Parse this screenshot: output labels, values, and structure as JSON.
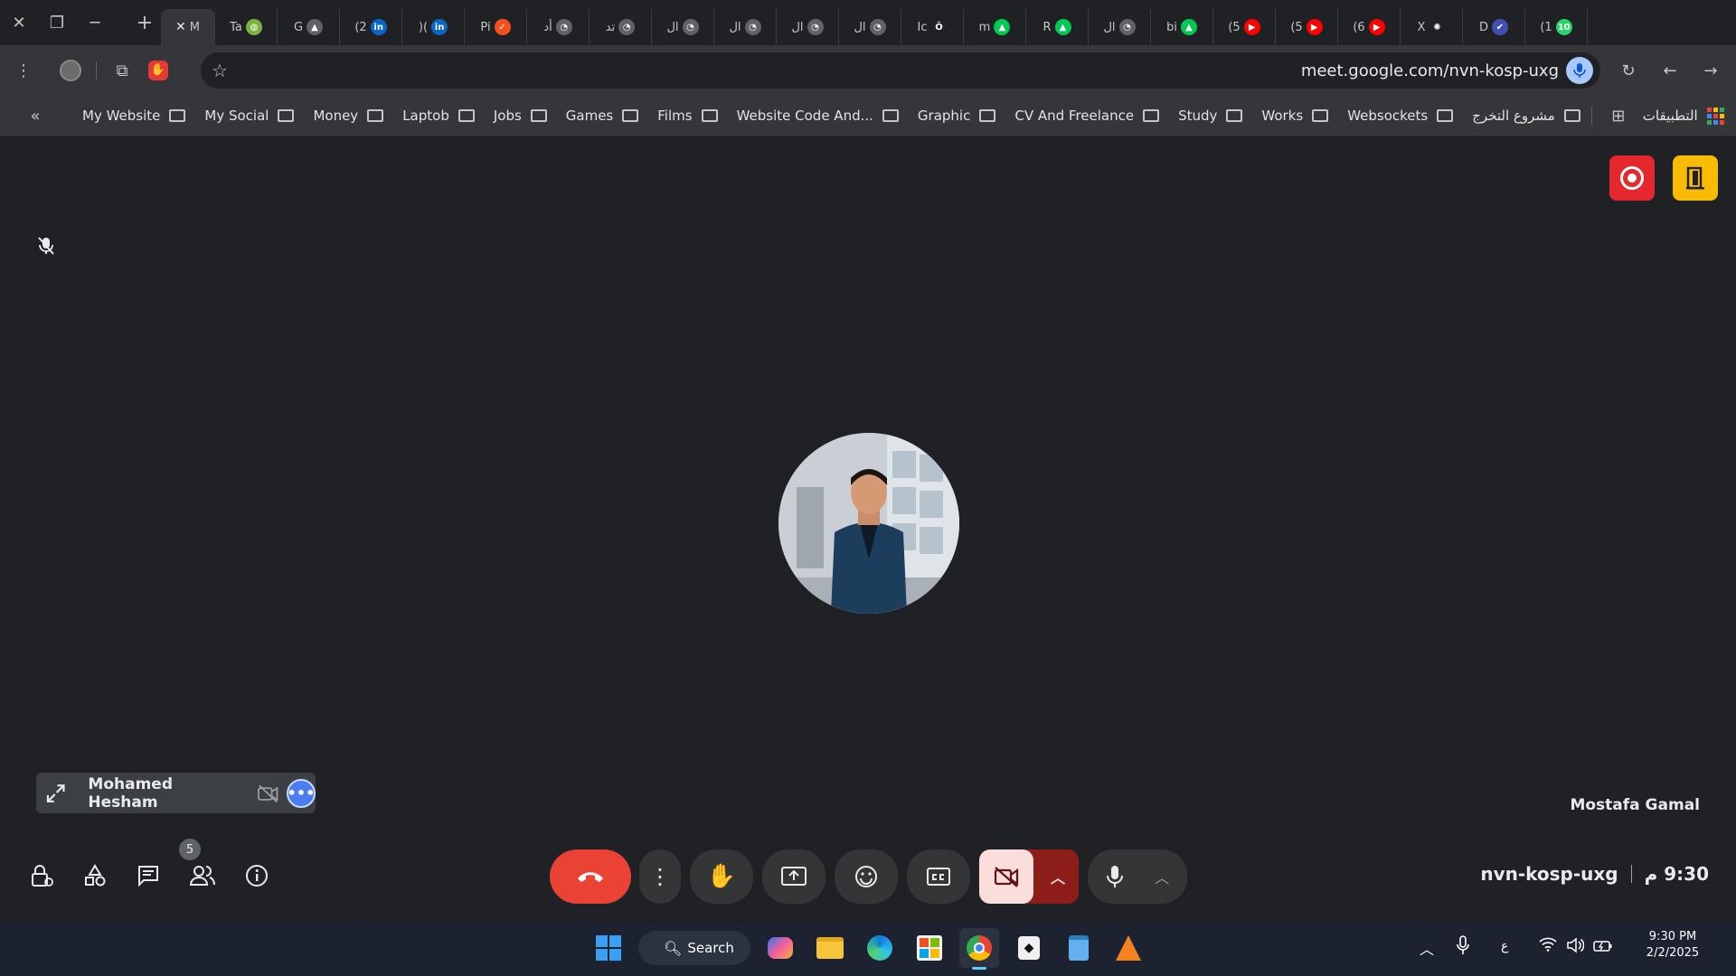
{
  "tabs": [
    {
      "label": "Ta",
      "fav_color": "#7cb342",
      "fav": "◍"
    },
    {
      "label": "G",
      "fav_color": "#5f6368",
      "fav": "▲"
    },
    {
      "label": "(2",
      "fav_color": "#0a66c2",
      "fav": "in"
    },
    {
      "label": ")(",
      "fav_color": "#0a66c2",
      "fav": "in"
    },
    {
      "label": "Pi",
      "fav_color": "#f4511e",
      "fav": "✓"
    },
    {
      "label": "أد",
      "fav_color": "#5f6368",
      "fav": "◔"
    },
    {
      "label": "تد",
      "fav_color": "#5f6368",
      "fav": "◔"
    },
    {
      "label": "ال",
      "fav_color": "#5f6368",
      "fav": "◔"
    },
    {
      "label": "ال",
      "fav_color": "#5f6368",
      "fav": "◔"
    },
    {
      "label": "ال",
      "fav_color": "#5f6368",
      "fav": "◔"
    },
    {
      "label": "ال",
      "fav_color": "#5f6368",
      "fav": "◔"
    },
    {
      "label": "Ic",
      "fav_color": "#202124",
      "fav": "Ô"
    },
    {
      "label": "m",
      "fav_color": "#00c853",
      "fav": "▲"
    },
    {
      "label": "R",
      "fav_color": "#00c853",
      "fav": "▲"
    },
    {
      "label": "ال",
      "fav_color": "#5f6368",
      "fav": "◔"
    },
    {
      "label": "bi",
      "fav_color": "#00c853",
      "fav": "▲"
    },
    {
      "label": "(5",
      "fav_color": "#ff0000",
      "fav": "▶"
    },
    {
      "label": "(5",
      "fav_color": "#ff0000",
      "fav": "▶"
    },
    {
      "label": "(6",
      "fav_color": "#ff0000",
      "fav": "▶"
    },
    {
      "label": "X",
      "fav_color": "#202124",
      "fav": "✺"
    },
    {
      "label": "D",
      "fav_color": "#3f51b5",
      "fav": "✔"
    },
    {
      "label": "(1",
      "fav_color": "#25d366",
      "fav": "10"
    }
  ],
  "active_tab": {
    "label": "M"
  },
  "url": "meet.google.com/nvn-kosp-uxg",
  "bookmarks": [
    "My Website",
    "My Social",
    "Money",
    "Laptob",
    "Jobs",
    "Games",
    "Films",
    "Website Code And...",
    "Graphic",
    "CV And Freelance",
    "Study",
    "Works",
    "Websockets",
    "مشروع التخرج"
  ],
  "apps_label": "التطبيقات",
  "meeting": {
    "self_name": "Mohamed Hesham",
    "remote_name": "Mostafa Gamal",
    "meeting_code": "nvn-kosp-uxg",
    "time": "9:30 م",
    "people_count": "5"
  },
  "taskbar": {
    "search_label": "Search",
    "clock_time": "9:30 PM",
    "clock_date": "2/2/2025",
    "lang": "ع"
  },
  "colors": {
    "end_call": "#ea4335",
    "camera_off": "#f9dedc",
    "camera_chevron": "#8c1d18",
    "record": "#e5282d",
    "rooms": "#f9bb03",
    "button": "#333537"
  }
}
